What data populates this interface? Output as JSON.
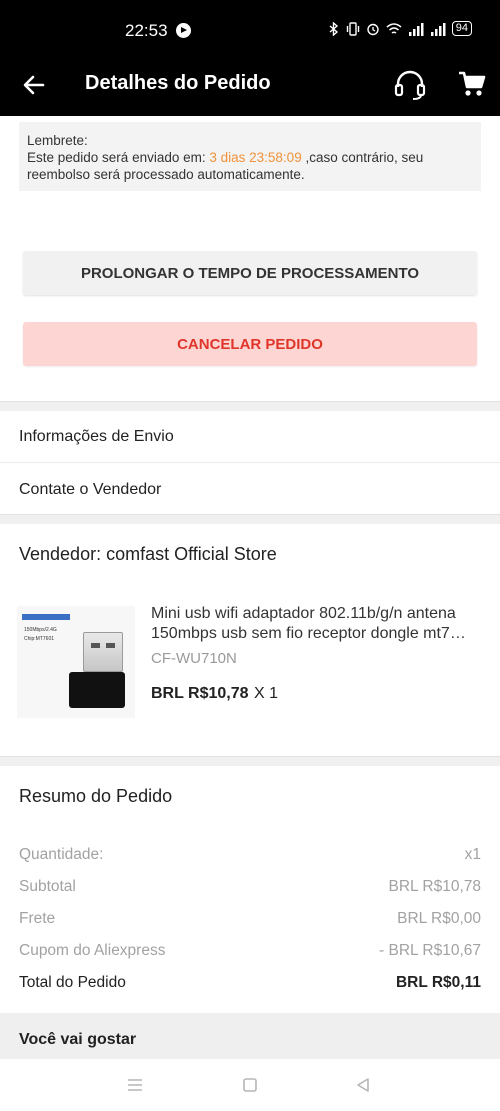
{
  "status_bar": {
    "time": "22:53",
    "icons": [
      "bluetooth-icon",
      "vibrate-icon",
      "alarm-icon",
      "wifi-icon",
      "signal-icon",
      "signal-icon"
    ],
    "battery": "94"
  },
  "header": {
    "title": "Detalhes do Pedido",
    "icons": [
      "back-arrow-icon",
      "headset-icon",
      "cart-icon"
    ]
  },
  "reminder": {
    "label": "Lembrete:",
    "text_before": "Este pedido será enviado em: ",
    "timer": "3 dias 23:58:09",
    "text_after": " ,caso contrário, seu reembolso será processado automaticamente."
  },
  "actions": {
    "prolong_label": "PROLONGAR O TEMPO DE PROCESSAMENTO",
    "cancel_label": "CANCELAR PEDIDO"
  },
  "links": {
    "shipping_info": "Informações de Envio",
    "contact_seller": "Contate o Vendedor"
  },
  "seller": {
    "label": "Vendedor: comfast Official Store"
  },
  "product": {
    "name": "Mini usb wifi adaptador 802.11b/g/n antena 150mbps usb sem fio receptor dongle mt7…",
    "sku": "CF-WU710N",
    "price": "BRL R$10,78",
    "quantity": "X 1",
    "image_text": [
      "150Mbps/2.4G",
      "Chip:MT7601"
    ]
  },
  "summary": {
    "title": "Resumo do Pedido",
    "rows": [
      {
        "label": "Quantidade:",
        "value": "x1"
      },
      {
        "label": "Subtotal",
        "value": "BRL R$10,78"
      },
      {
        "label": "Frete",
        "value": "BRL R$0,00"
      },
      {
        "label": "Cupom do Aliexpress",
        "value": "- BRL R$10,67"
      }
    ],
    "total_label": "Total do Pedido",
    "total_value": "BRL R$0,11"
  },
  "recommend": {
    "title": "Você vai gostar"
  },
  "colors": {
    "timer": "#f0923a",
    "cancel_text": "#e0352b",
    "cancel_bg": "#fdd6d3"
  },
  "nav": {
    "icons": [
      "menu-icon",
      "home-square-icon",
      "back-triangle-icon"
    ]
  }
}
